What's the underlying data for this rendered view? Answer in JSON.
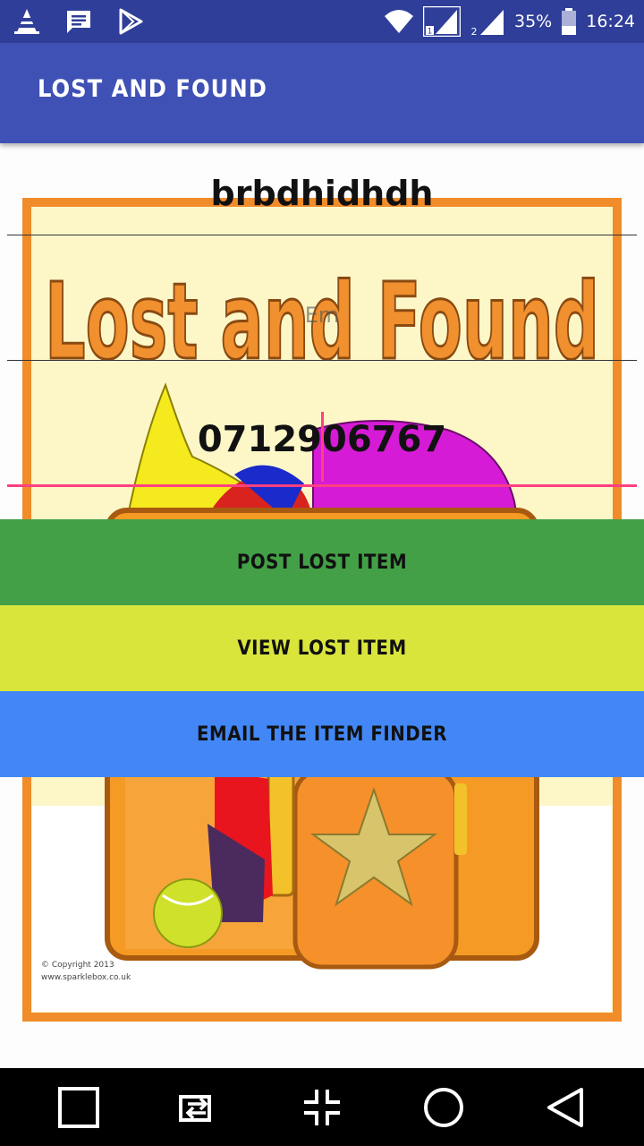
{
  "status_bar": {
    "battery": "35%",
    "time": "16:24",
    "sim1": "1",
    "sim2": "2"
  },
  "app_bar": {
    "title": "LOST AND FOUND"
  },
  "form": {
    "name_value": "brbdhidhdh",
    "email_value": "",
    "email_hint": "Em",
    "phone_value": "0712906767"
  },
  "poster": {
    "banner_text": "Lost and Found",
    "copyright_line1": "© Copyright 2013",
    "copyright_line2": "www.sparklebox.co.uk"
  },
  "buttons": {
    "post_label": "POST LOST ITEM",
    "view_label": "VIEW LOST ITEM",
    "email_label": "EMAIL THE ITEM FINDER"
  },
  "colors": {
    "status_bar": "#2f3e98",
    "app_bar": "#3f51b5",
    "post_button": "#43a047",
    "view_button": "#d9e53b",
    "email_button": "#4287f5",
    "focus_accent": "#ff4081"
  },
  "icons": {
    "status_left": [
      "vlc-cone-icon",
      "message-icon",
      "play-store-icon"
    ],
    "status_right": [
      "wifi-icon",
      "signal-sim1-icon",
      "signal-sim2-icon",
      "battery-icon"
    ],
    "nav": [
      "recent-apps-icon",
      "switch-app-icon",
      "fullscreen-exit-icon",
      "home-icon",
      "back-icon"
    ]
  }
}
